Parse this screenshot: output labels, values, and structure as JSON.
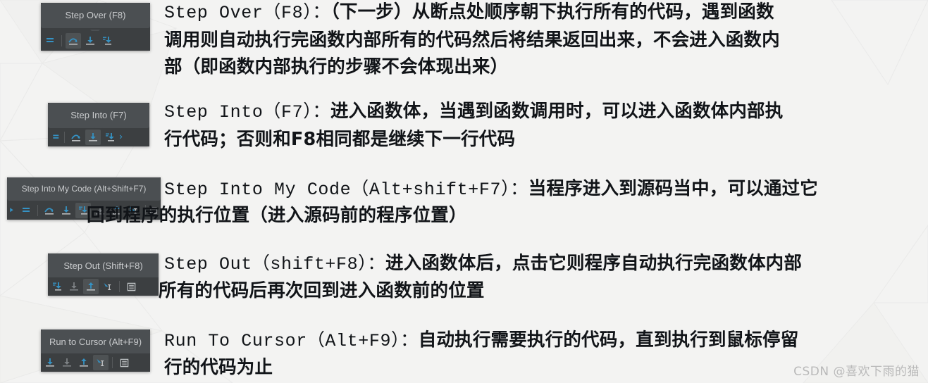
{
  "slide": {
    "background_color": "#f3f3f2",
    "text_color": "#111418",
    "accent_color": "#3592c4",
    "toolbar_bg": "#3c3f41",
    "tooltip_bg": "#4b4f52",
    "tooltip_text_color": "#c9cbcd"
  },
  "watermark": "CSDN @喜欢下雨的猫",
  "sections": [
    {
      "id": "step-over",
      "tooltip": "Step Over (F8)",
      "heading": "Step Over（F8）：",
      "body_line1": "（下一步）从断点处顺序朝下执行所有的代码，遇到函数",
      "body_line2": "调用则自动执行完函数内部所有的代码然后将结果返回出来，不会进入函数内",
      "body_line3": "部（即函数内部执行的步骤不会体现出来）"
    },
    {
      "id": "step-into",
      "tooltip": "Step Into (F7)",
      "heading": "Step Into（F7）：",
      "body_line1": "进入函数体，当遇到函数调用时，可以进入函数体内部执",
      "body_line2": "行代码；否则和F8相同都是继续下一行代码"
    },
    {
      "id": "step-into-my-code",
      "tooltip": "Step Into My Code (Alt+Shift+F7)",
      "heading": "Step Into My Code（Alt+shift+F7）：",
      "body_line1": "当程序进入到源码当中，可以通过它",
      "body_line2": "回到程序的执行位置（进入源码前的程序位置）"
    },
    {
      "id": "step-out",
      "tooltip": "Step Out (Shift+F8)",
      "heading": "Step Out（shift+F8）：",
      "body_line1": "进入函数体后，点击它则程序自动执行完函数体内部",
      "body_line2": "所有的代码后再次回到进入函数前的位置"
    },
    {
      "id": "run-to-cursor",
      "tooltip": "Run to Cursor (Alt+F9)",
      "heading": "Run To Cursor（Alt+F9）：",
      "body_line1": "自动执行需要执行的代码，直到执行到鼠标停留",
      "body_line2": "行的代码为止"
    }
  ],
  "icons": {
    "show_execution_point": "show-execution-point-icon",
    "step_over": "step-over-icon",
    "step_into": "step-into-icon",
    "step_into_my_code": "step-into-my-code-icon",
    "force_step_into": "force-step-into-icon",
    "step_out": "step-out-icon",
    "run_to_cursor": "run-to-cursor-icon",
    "evaluate_expression": "evaluate-expression-icon"
  }
}
